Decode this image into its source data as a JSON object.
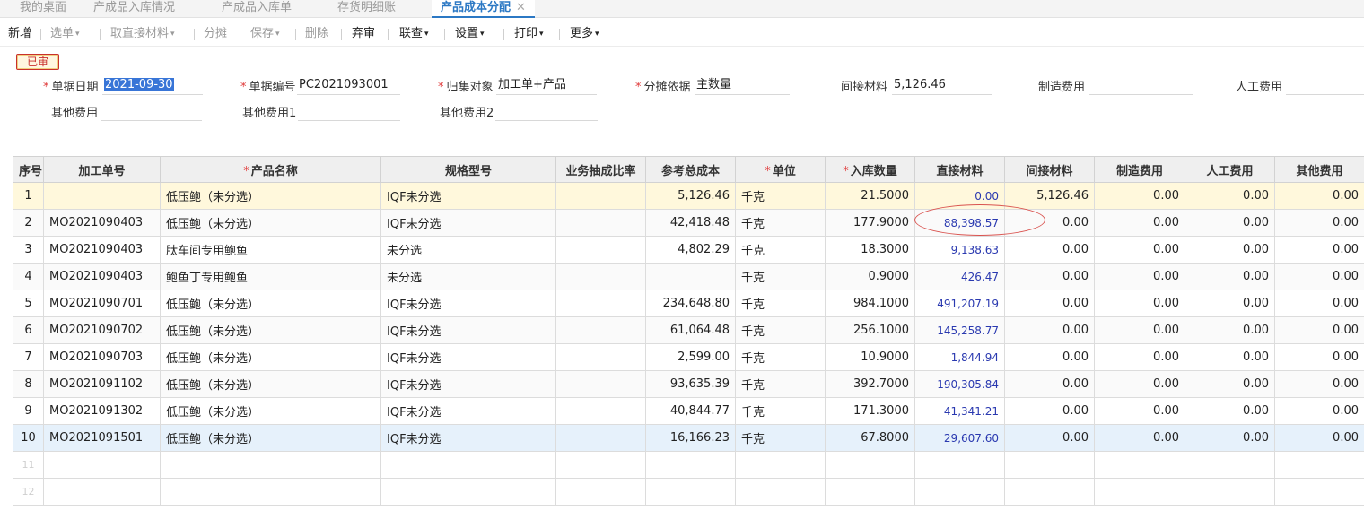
{
  "tabs": [
    {
      "label": "我的桌面"
    },
    {
      "label": "产成品入库情况"
    },
    {
      "label": "产成品入库单"
    },
    {
      "label": "存货明细账"
    },
    {
      "label": "产品成本分配",
      "active": true
    }
  ],
  "tab_close": "✕",
  "toolbar": {
    "new": "新增",
    "select": "选单",
    "fetch_material": "取直接材料",
    "allocate": "分摊",
    "save": "保存",
    "delete": "删除",
    "unaudit": "弃审",
    "link": "联查",
    "settings": "设置",
    "print": "打印",
    "more": "更多"
  },
  "status_badge": "已审",
  "form": {
    "date": {
      "label": "单据日期",
      "value": "2021-09-30"
    },
    "doc_no": {
      "label": "单据编号",
      "value": "PC2021093001"
    },
    "collect_target": {
      "label": "归集对象",
      "value": "加工单+产品"
    },
    "alloc_basis": {
      "label": "分摊依据",
      "value": "主数量"
    },
    "indirect_material": {
      "label": "间接材料",
      "value": "5,126.46"
    },
    "mfg_expense": {
      "label": "制造费用",
      "value": ""
    },
    "labor_cost": {
      "label": "人工费用",
      "value": ""
    },
    "other_expense": {
      "label": "其他费用",
      "value": ""
    },
    "other_expense1": {
      "label": "其他费用1",
      "value": ""
    },
    "other_expense2": {
      "label": "其他费用2",
      "value": ""
    }
  },
  "grid": {
    "headers": [
      "序号",
      "加工单号",
      "产品名称",
      "规格型号",
      "业务抽成比率",
      "参考总成本",
      "单位",
      "入库数量",
      "直接材料",
      "间接材料",
      "制造费用",
      "人工费用",
      "其他费用"
    ],
    "rows": [
      [
        "1",
        "",
        "低压鲍（未分选）",
        "IQF未分选",
        "",
        "5,126.46",
        "千克",
        "21.5000",
        "0.00",
        "5,126.46",
        "0.00",
        "0.00",
        "0.00"
      ],
      [
        "2",
        "MO2021090403",
        "低压鲍（未分选）",
        "IQF未分选",
        "",
        "42,418.48",
        "千克",
        "177.9000",
        "88,398.57",
        "0.00",
        "0.00",
        "0.00",
        "0.00"
      ],
      [
        "3",
        "MO2021090403",
        "肽车间专用鲍鱼",
        "未分选",
        "",
        "4,802.29",
        "千克",
        "18.3000",
        "9,138.63",
        "0.00",
        "0.00",
        "0.00",
        "0.00"
      ],
      [
        "4",
        "MO2021090403",
        "鲍鱼丁专用鲍鱼",
        "未分选",
        "",
        "",
        "千克",
        "0.9000",
        "426.47",
        "0.00",
        "0.00",
        "0.00",
        "0.00"
      ],
      [
        "5",
        "MO2021090701",
        "低压鲍（未分选）",
        "IQF未分选",
        "",
        "234,648.80",
        "千克",
        "984.1000",
        "491,207.19",
        "0.00",
        "0.00",
        "0.00",
        "0.00"
      ],
      [
        "6",
        "MO2021090702",
        "低压鲍（未分选）",
        "IQF未分选",
        "",
        "61,064.48",
        "千克",
        "256.1000",
        "145,258.77",
        "0.00",
        "0.00",
        "0.00",
        "0.00"
      ],
      [
        "7",
        "MO2021090703",
        "低压鲍（未分选）",
        "IQF未分选",
        "",
        "2,599.00",
        "千克",
        "10.9000",
        "1,844.94",
        "0.00",
        "0.00",
        "0.00",
        "0.00"
      ],
      [
        "8",
        "MO2021091102",
        "低压鲍（未分选）",
        "IQF未分选",
        "",
        "93,635.39",
        "千克",
        "392.7000",
        "190,305.84",
        "0.00",
        "0.00",
        "0.00",
        "0.00"
      ],
      [
        "9",
        "MO2021091302",
        "低压鲍（未分选）",
        "IQF未分选",
        "",
        "40,844.77",
        "千克",
        "171.3000",
        "41,341.21",
        "0.00",
        "0.00",
        "0.00",
        "0.00"
      ],
      [
        "10",
        "MO2021091501",
        "低压鲍（未分选）",
        "IQF未分选",
        "",
        "16,166.23",
        "千克",
        "67.8000",
        "29,607.60",
        "0.00",
        "0.00",
        "0.00",
        "0.00"
      ]
    ],
    "empty_rows": [
      "11",
      "12"
    ]
  },
  "colors": {
    "accent": "#2b78c4",
    "required": "#e03b3b",
    "audit_badge": "#c9302c",
    "direct_material_text": "#2a39b0",
    "first_row_bg": "#fff8dc",
    "selected_row_bg": "#e6f1fb"
  }
}
